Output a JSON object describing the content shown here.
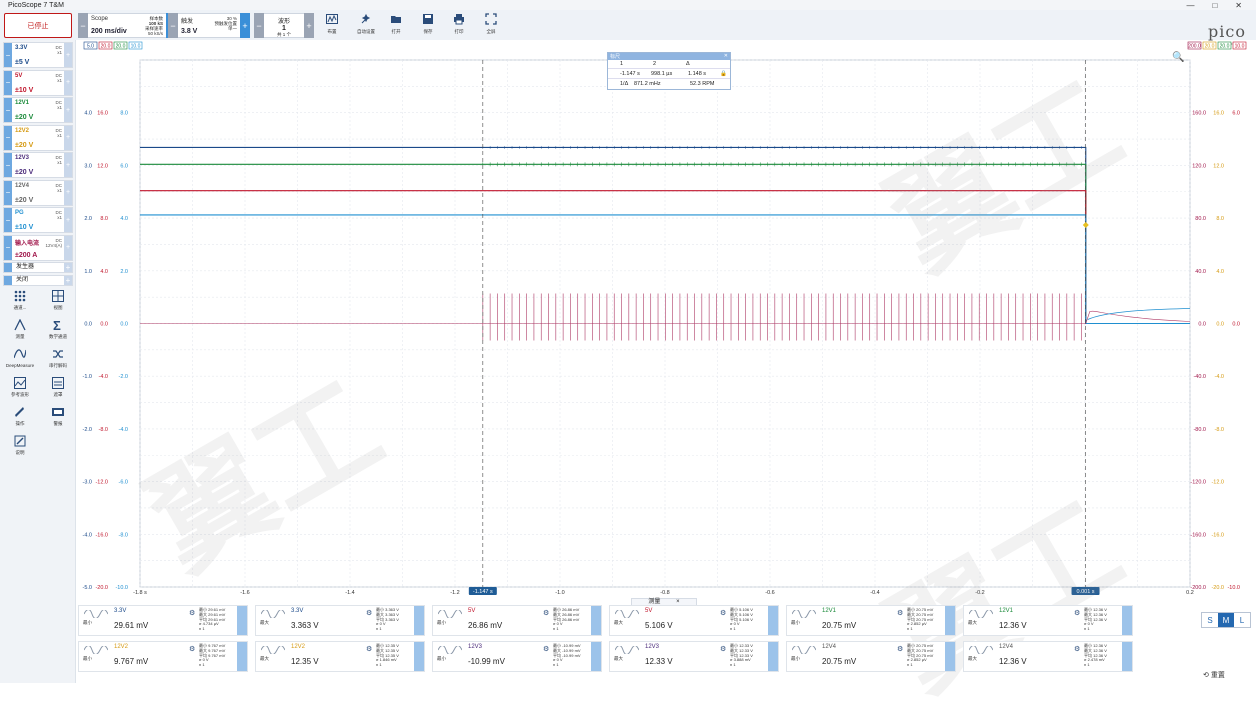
{
  "window": {
    "title": "PicoScope 7 T&M",
    "controls": [
      "—",
      "□",
      "✕"
    ]
  },
  "toolbar": {
    "stop_label": "已停止",
    "scope": {
      "label": "Scope",
      "value": "200 ms/div",
      "small": [
        "样本数",
        "100 kS",
        "采样速率",
        "50 kS/s"
      ]
    },
    "trigger": {
      "label": "触发",
      "value": "3.8 V",
      "small": [
        "30 %",
        "预触发位置",
        "单一"
      ]
    },
    "waveform": {
      "label": "波形",
      "value": "1",
      "sub": "共 1 个"
    },
    "icons": [
      {
        "name": "layout-icon",
        "label": "布置"
      },
      {
        "name": "autosetup-icon",
        "label": "自动设置"
      },
      {
        "name": "open-icon",
        "label": "打开"
      },
      {
        "name": "save-icon",
        "label": "保存"
      },
      {
        "name": "print-icon",
        "label": "打印"
      },
      {
        "name": "fullscreen-icon",
        "label": "全屏"
      }
    ],
    "logo": "pico",
    "logo_sub": "Technology"
  },
  "channels": [
    {
      "name": "3.3V",
      "range": "±5 V",
      "coupling": "DC",
      "probe": "x1",
      "color": "#1b4a8a"
    },
    {
      "name": "5V",
      "range": "±10 V",
      "coupling": "DC",
      "probe": "x1",
      "color": "#c0162c"
    },
    {
      "name": "12V1",
      "range": "±20 V",
      "coupling": "DC",
      "probe": "x1",
      "color": "#1a8a3a"
    },
    {
      "name": "12V2",
      "range": "±20 V",
      "coupling": "DC",
      "probe": "x1",
      "color": "#d59a12"
    },
    {
      "name": "12V3",
      "range": "±20 V",
      "coupling": "DC",
      "probe": "x1",
      "color": "#4a2a7a"
    },
    {
      "name": "12V4",
      "range": "±20 V",
      "coupling": "DC",
      "probe": "x1",
      "color": "#666666"
    },
    {
      "name": "PG",
      "range": "±10 V",
      "coupling": "DC",
      "probe": "x1",
      "color": "#1f8fd0"
    },
    {
      "name": "输入电流",
      "range": "±200 A",
      "coupling": "DC",
      "probe": "12V4(A)",
      "color": "#a0164a"
    }
  ],
  "generators": [
    {
      "label": "发生器"
    },
    {
      "label": "关闭"
    }
  ],
  "tools": [
    {
      "name": "channels-icon",
      "label": "通道..."
    },
    {
      "name": "views-icon",
      "label": "视图"
    },
    {
      "name": "measure-icon",
      "label": "测量"
    },
    {
      "name": "math-icon",
      "label": "数学通道"
    },
    {
      "name": "deepmeasure-icon",
      "label": "DeepMeasure"
    },
    {
      "name": "serial-icon",
      "label": "串行解码"
    },
    {
      "name": "reference-icon",
      "label": "参考波形"
    },
    {
      "name": "mask-icon",
      "label": "遮罩"
    },
    {
      "name": "actions-icon",
      "label": "操作"
    },
    {
      "name": "alarm-icon",
      "label": "警报"
    },
    {
      "name": "notes-icon",
      "label": "说明"
    }
  ],
  "chart_data": {
    "type": "line",
    "x_ticks": [
      "-1.8 s",
      "-1.6",
      "-1.4",
      "-1.2",
      "-1.0",
      "-0.8",
      "-0.6",
      "-0.4",
      "-0.2",
      "0.2"
    ],
    "x_ticks_values": [
      -1.8,
      -1.6,
      -1.4,
      -1.2,
      -1.0,
      -0.8,
      -0.6,
      -0.4,
      -0.2,
      0.2
    ],
    "xlim": [
      -1.8,
      0.2
    ],
    "left_axes": [
      {
        "ticks": [
          "4.0",
          "3.0",
          "2.0",
          "1.0",
          "0.0",
          "-1.0",
          "-2.0",
          "-3.0",
          "-4.0",
          "-5.0"
        ],
        "color": "#1b4a8a"
      },
      {
        "ticks": [
          "16.0",
          "12.0",
          "8.0",
          "4.0",
          "0.0",
          "-4.0",
          "-8.0",
          "-12.0",
          "-16.0",
          "-20.0"
        ],
        "color": "#c0162c"
      },
      {
        "ticks": [
          "8.0",
          "6.0",
          "4.0",
          "2.0",
          "0.0",
          "-2.0",
          "-4.0",
          "-6.0",
          "-8.0",
          "-10.0"
        ],
        "color": "#1f8fd0"
      }
    ],
    "right_axes": [
      {
        "ticks": [
          "160.0",
          "120.0",
          "80.0",
          "40.0",
          "0.0",
          "-40.0",
          "-80.0",
          "-120.0",
          "-160.0",
          "-200.0"
        ],
        "color": "#a0164a"
      },
      {
        "ticks": [
          "16.0",
          "12.0",
          "8.0",
          "4.0",
          "0.0",
          "-4.0",
          "-8.0",
          "-12.0",
          "-16.0",
          "-20.0"
        ],
        "color": "#d59a12"
      },
      {
        "ticks": [
          "6.0",
          "",
          "",
          "",
          "0.0",
          "",
          "",
          "",
          "",
          "-10.0"
        ],
        "color": "#c0162c"
      }
    ],
    "top_left_labels": [
      "5.0",
      "20.0",
      "20.0",
      "10.0"
    ],
    "top_right_labels": [
      "200.0",
      "20.0",
      "20.0",
      "10.0"
    ],
    "series": [
      {
        "name": "3.3V",
        "level": 3.34,
        "axis": 0,
        "color": "#1b4a8a"
      },
      {
        "name": "12V1",
        "level": 3.02,
        "axis": 0,
        "color": "#1a8a3a"
      },
      {
        "name": "5V",
        "level": 2.52,
        "axis": 0,
        "color": "#c0162c"
      },
      {
        "name": "PG",
        "level": 2.06,
        "axis": 0,
        "color": "#1f8fd0"
      },
      {
        "name": "输入电流",
        "level": 0.0,
        "axis": 0,
        "color": "#a0164a"
      }
    ],
    "cursors": [
      {
        "label": "-1.147 s",
        "x": -1.147
      },
      {
        "label": "0.001 s",
        "x": 0.001
      }
    ],
    "trigger_time": 0.0
  },
  "rulers": {
    "title": "标尺",
    "headers": [
      "1",
      "2",
      "Δ"
    ],
    "row1": [
      "-1.147 s",
      "998.1 µs",
      "1.148 s"
    ],
    "row2": [
      "1/Δ",
      "871.2 mHz",
      "52.3 RPM"
    ]
  },
  "measurements_tab": "测量",
  "measurements": [
    {
      "name": "3.3V",
      "value": "29.61 mV",
      "stat": "最小",
      "stats": [
        "最小 29.61 mV",
        "最大 29.61 mV",
        "平均 29.61 mV",
        "σ 4.734 µV",
        "n 1"
      ]
    },
    {
      "name": "3.3V",
      "value": "3.363 V",
      "stat": "最大",
      "stats": [
        "最小 3.363 V",
        "最大 3.363 V",
        "平均 3.363 V",
        "σ 0 V",
        "n 1"
      ]
    },
    {
      "name": "5V",
      "value": "26.86 mV",
      "stat": "最小",
      "stats": [
        "最小 26.86 mV",
        "最大 26.86 mV",
        "平均 26.86 mV",
        "σ 0 V",
        "n 1"
      ]
    },
    {
      "name": "5V",
      "value": "5.106 V",
      "stat": "最大",
      "stats": [
        "最小 5.106 V",
        "最大 5.106 V",
        "平均 5.106 V",
        "σ 0 V",
        "n 1"
      ]
    },
    {
      "name": "12V1",
      "value": "20.75 mV",
      "stat": "最小",
      "stats": [
        "最小 20.75 mV",
        "最大 20.75 mV",
        "平均 20.75 mV",
        "σ 2.852 µV",
        "n 1"
      ]
    },
    {
      "name": "12V1",
      "value": "12.36 V",
      "stat": "最大",
      "stats": [
        "最小 12.36 V",
        "最大 12.36 V",
        "平均 12.36 V",
        "σ 0 V",
        "n 1"
      ]
    },
    {
      "name": "12V2",
      "value": "9.767 mV",
      "stat": "最小",
      "stats": [
        "最小 9.767 mV",
        "最大 9.767 mV",
        "平均 9.767 mV",
        "σ 0 V",
        "n 1"
      ]
    },
    {
      "name": "12V2",
      "value": "12.35 V",
      "stat": "最大",
      "stats": [
        "最小 12.35 V",
        "最大 12.35 V",
        "平均 12.35 V",
        "σ 1.846 mV",
        "n 1"
      ]
    },
    {
      "name": "12V3",
      "value": "-10.99 mV",
      "stat": "最小",
      "stats": [
        "最小 -10.99 mV",
        "最大 -10.99 mV",
        "平均 -10.99 mV",
        "σ 0 V",
        "n 1"
      ]
    },
    {
      "name": "12V3",
      "value": "12.33 V",
      "stat": "最大",
      "stats": [
        "最小 12.33 V",
        "最大 12.33 V",
        "平均 12.33 V",
        "σ 3.888 mV",
        "n 1"
      ]
    },
    {
      "name": "12V4",
      "value": "20.75 mV",
      "stat": "最小",
      "stats": [
        "最小 20.75 mV",
        "最大 20.75 mV",
        "平均 20.75 mV",
        "σ 2.852 µV",
        "n 1"
      ]
    },
    {
      "name": "12V4",
      "value": "12.36 V",
      "stat": "最大",
      "stats": [
        "最小 12.36 V",
        "最大 12.36 V",
        "平均 12.36 V",
        "σ 2.478 mV",
        "n 1"
      ]
    }
  ],
  "size_buttons": [
    "S",
    "M",
    "L"
  ],
  "size_selected": "M",
  "reset_label": "重置",
  "watermark": "翼工"
}
